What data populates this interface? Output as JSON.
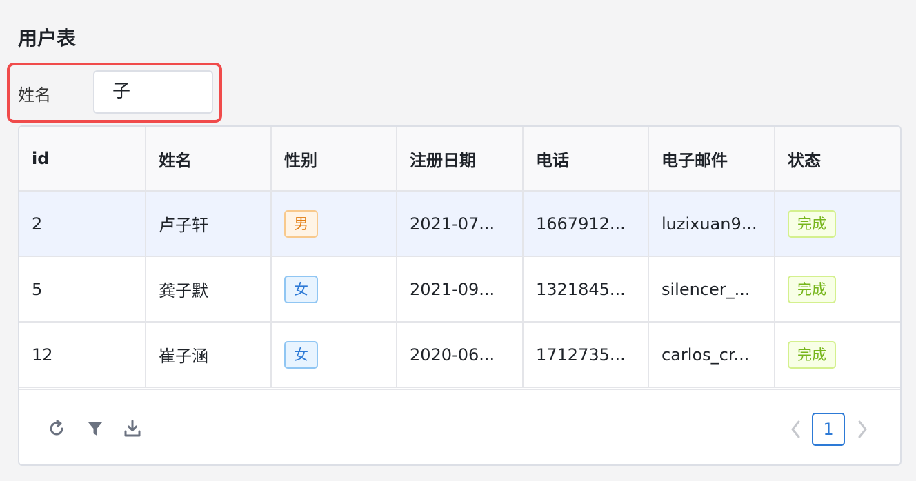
{
  "page": {
    "title": "用户表"
  },
  "filter": {
    "label": "姓名",
    "value": "子"
  },
  "table": {
    "columns": [
      "id",
      "姓名",
      "性别",
      "注册日期",
      "电话",
      "电子邮件",
      "状态"
    ],
    "rows": [
      {
        "id": "2",
        "name": "卢子轩",
        "gender": "男",
        "gender_type": "male",
        "date": "2021-07...",
        "phone": "1667912...",
        "email": "luzixuan9...",
        "status": "完成",
        "highlighted": true
      },
      {
        "id": "5",
        "name": "龚子默",
        "gender": "女",
        "gender_type": "female",
        "date": "2021-09...",
        "phone": "1321845...",
        "email": "silencer_...",
        "status": "完成",
        "highlighted": false
      },
      {
        "id": "12",
        "name": "崔子涵",
        "gender": "女",
        "gender_type": "female",
        "date": "2020-06...",
        "phone": "1712735...",
        "email": "carlos_cr...",
        "status": "完成",
        "highlighted": false
      }
    ]
  },
  "toolbar": {
    "icons": [
      "refresh-icon",
      "filter-icon",
      "download-icon"
    ]
  },
  "pagination": {
    "current_page": "1"
  },
  "colors": {
    "accent": "#2d7ad6",
    "highlight_row": "#eef3fe",
    "focus_border": "#f04b4b"
  }
}
